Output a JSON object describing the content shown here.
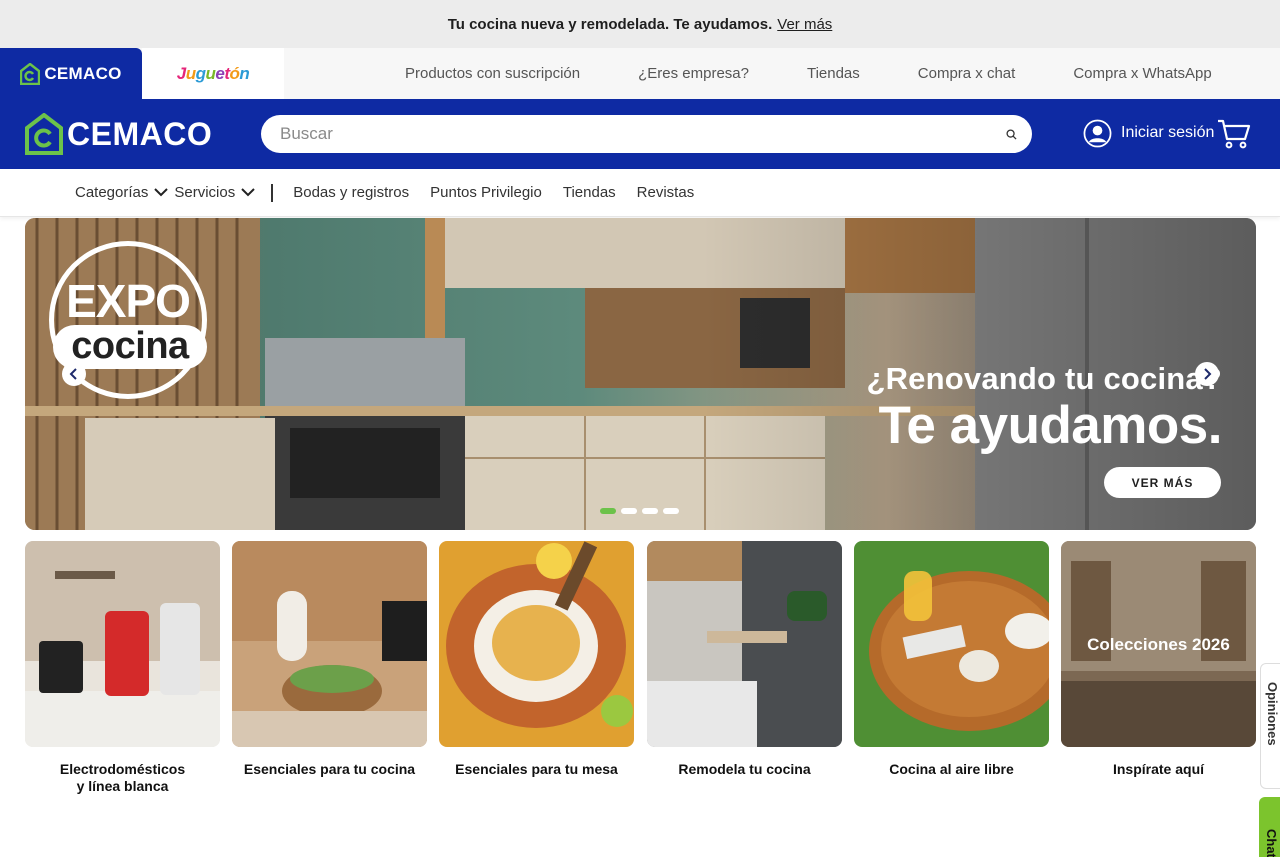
{
  "promo": {
    "text": "Tu cocina nueva y remodelada. Te ayudamos.",
    "link": "Ver más"
  },
  "brands": {
    "primary": "CEMACO",
    "secondary_letters": [
      "J",
      "u",
      "g",
      "u",
      "e",
      "t",
      "ó",
      "n",
      ""
    ]
  },
  "top_links": [
    "Productos con suscripción",
    "¿Eres empresa?",
    "Tiendas",
    "Compra x chat",
    "Compra x WhatsApp"
  ],
  "header": {
    "logo": "CEMACO",
    "search_placeholder": "Buscar",
    "login": "Iniciar sesión"
  },
  "nav": {
    "categories": "Categorías",
    "services": "Servicios",
    "links": [
      "Bodas y registros",
      "Puntos Privilegio",
      "Tiendas",
      "Revistas"
    ]
  },
  "hero": {
    "badge_top": "EXPO",
    "badge_bottom": "cocina",
    "heading_line1": "¿Renovando tu cocina?",
    "heading_line2": "Te ayudamos.",
    "cta": "VER MÁS",
    "slide_count": 4,
    "active_slide": 0
  },
  "categories": [
    {
      "label": "Electrodomésticos\ny línea blanca",
      "overlay": ""
    },
    {
      "label": "Esenciales para tu cocina",
      "overlay": ""
    },
    {
      "label": "Esenciales para tu mesa",
      "overlay": ""
    },
    {
      "label": "Remodela tu cocina",
      "overlay": ""
    },
    {
      "label": "Cocina al aire libre",
      "overlay": ""
    },
    {
      "label": "Inspírate aquí",
      "overlay": "Colecciones 2026"
    }
  ],
  "side_tabs": {
    "opinions": "Opiniones",
    "chat": "Chat"
  },
  "colors": {
    "brand_blue": "#0e2aa3",
    "accent_green": "#6cc24a",
    "chat_green": "#7cc42d"
  },
  "icons": [
    "cemaco-logo-icon",
    "search-icon",
    "user-icon",
    "cart-icon",
    "chevron-down-icon",
    "arrow-left-icon",
    "arrow-right-icon"
  ]
}
